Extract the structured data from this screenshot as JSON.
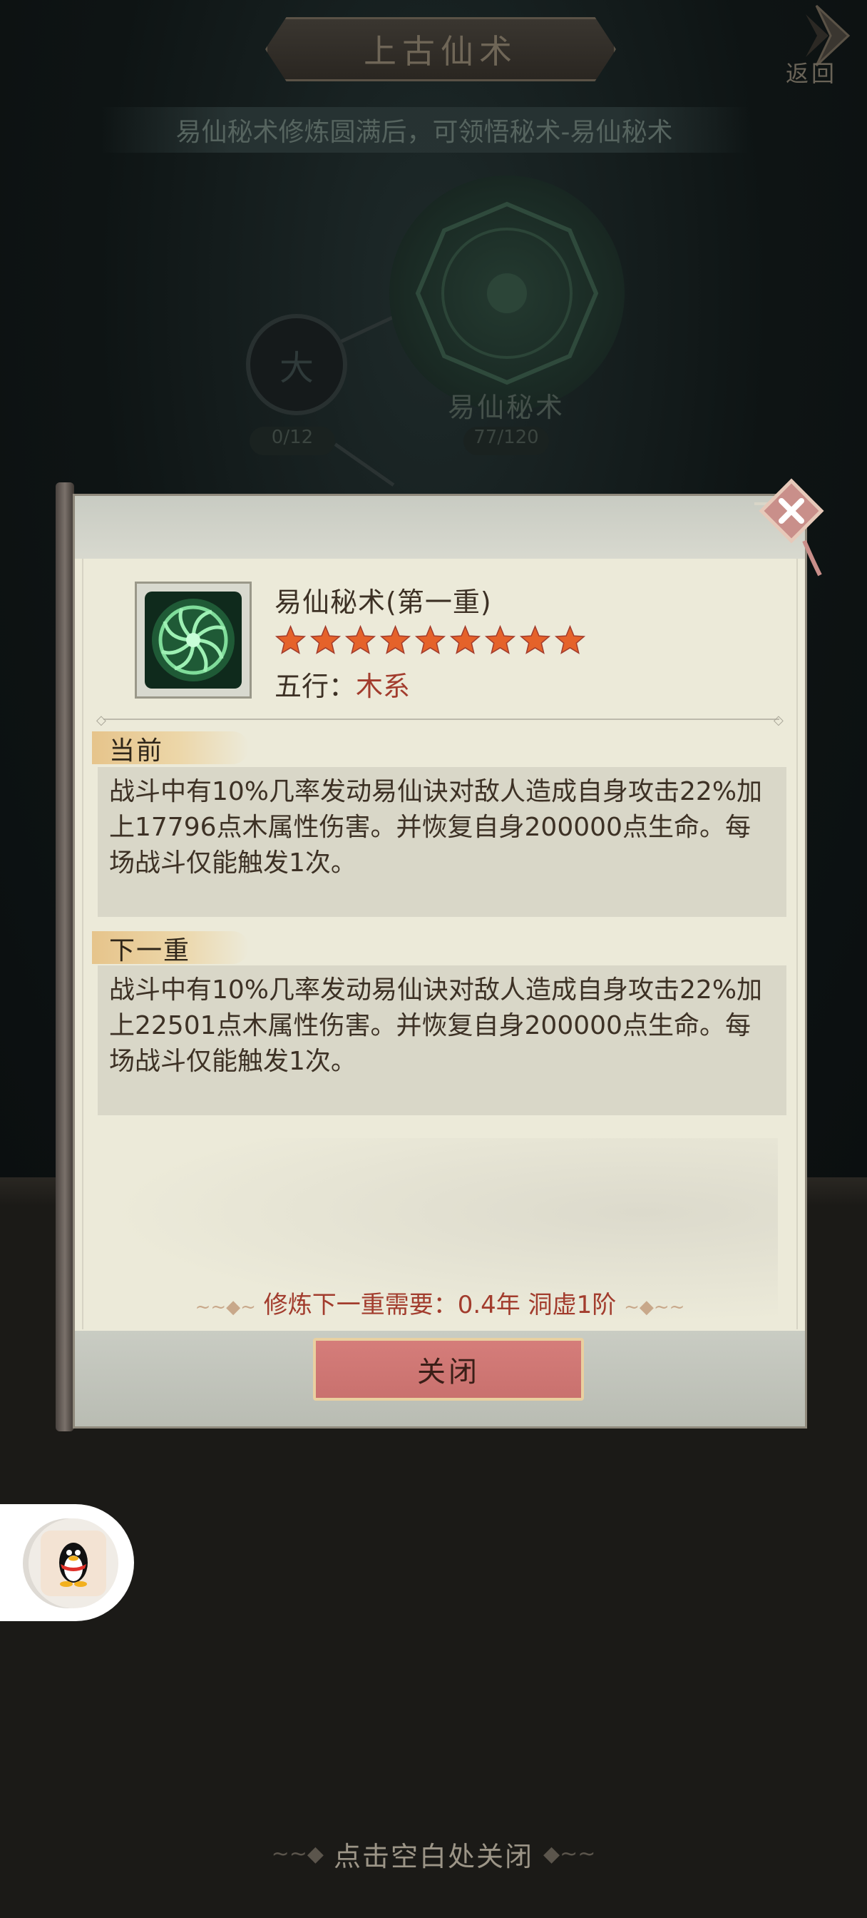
{
  "page": {
    "title": "上古仙术",
    "back_label": "返回",
    "hint": "易仙秘术修炼圆满后，可领悟秘术-易仙秘术",
    "footer_hint": "点击空白处关闭"
  },
  "skill_tree": {
    "main_node": {
      "name": "易仙秘术",
      "progress": "77/120"
    },
    "side_node": {
      "glyph": "大",
      "progress": "0/12"
    }
  },
  "dialog": {
    "skill_title": "易仙秘术(第一重)",
    "stars": {
      "count": 9,
      "color": "#e5622a"
    },
    "element_label": "五行：",
    "element_value": "木系",
    "current": {
      "label": "当前",
      "description": "战斗中有10%几率发动易仙诀对敌人造成自身攻击22%加上17796点木属性伤害。并恢复自身200000点生命。每场战斗仅能触发1次。"
    },
    "next": {
      "label": "下一重",
      "description": "战斗中有10%几率发动易仙诀对敌人造成自身攻击22%加上22501点木属性伤害。并恢复自身200000点生命。每场战斗仅能触发1次。"
    },
    "requirement": "修炼下一重需要：0.4年  洞虚1阶",
    "close_button": "关闭"
  },
  "icons": {
    "close": "close-x-icon",
    "back": "back-arrow-icon",
    "skill": "green-mandala-icon",
    "qq": "qq-penguin-icon"
  },
  "colors": {
    "accent_red": "#a23c2d",
    "button_red": "#d57d7a",
    "paper": "#ecead9"
  }
}
